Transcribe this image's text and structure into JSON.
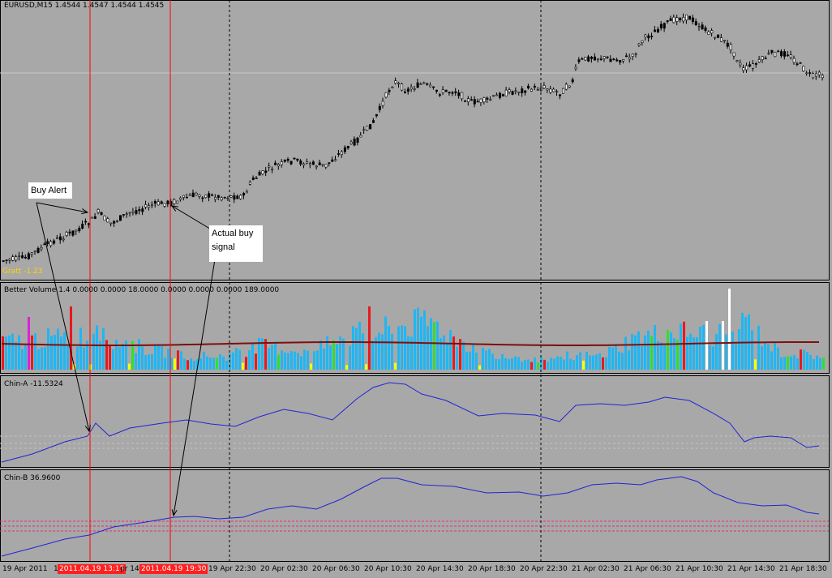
{
  "window": {
    "symbol_label": "EURUSD,M15  1.4544 1.4547 1.4544 1.4545",
    "grat_label": "Gratt -1.23"
  },
  "indicators": {
    "better_volume": "Better Volume 1.4 0.0000 0.0000 18.0000 0.0000 0.0000 0.0000 189.0000",
    "chin_a": "Chin-A -11.5324",
    "chin_b": "Chin-B 36.9600"
  },
  "annotations": {
    "buy_alert": "Buy Alert",
    "actual_buy_line1": "Actual buy",
    "actual_buy_line2": "signal"
  },
  "time_axis": {
    "labels": [
      "19 Apr 2011",
      "1",
      "pr 14",
      "19 Apr 22:30",
      "20 Apr 02:30",
      "20 Apr 06:30",
      "20 Apr 10:30",
      "20 Apr 14:30",
      "20 Apr 18:30",
      "20 Apr 22:30",
      "21 Apr 02:30",
      "21 Apr 06:30",
      "21 Apr 10:30",
      "21 Apr 14:30",
      "21 Apr 18:30"
    ],
    "highlighted": [
      "2011.04.19 13:15",
      "2011.04.19 19:30"
    ]
  },
  "colors": {
    "background": "#a8a8a8",
    "price_line": "#000000",
    "volume_bar": "#21b6f2",
    "volume_red": "#e8191c",
    "volume_green": "#2ee02e",
    "volume_yellow": "#ffff00",
    "volume_white": "#ffffff",
    "volume_magenta": "#d624d6",
    "volume_avg": "#7d0f0f",
    "chin_line": "#2323d6",
    "vline_red": "#ff0000"
  }
}
